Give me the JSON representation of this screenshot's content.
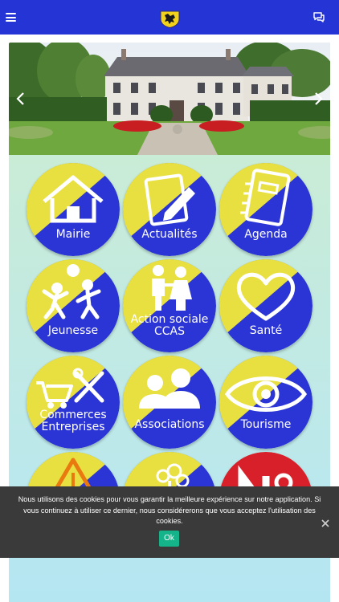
{
  "header": {
    "menu_icon": "hamburger-icon",
    "logo_icon": "crest-icon",
    "chat_icon": "chat-icon"
  },
  "slider": {
    "prev_icon": "chevron-left-icon",
    "next_icon": "chevron-right-icon"
  },
  "tiles": [
    {
      "label": "Mairie",
      "icon": "house-icon"
    },
    {
      "label": "Actualités",
      "icon": "notepad-pencil-icon"
    },
    {
      "label": "Agenda",
      "icon": "notebook-icon"
    },
    {
      "label": "Jeunesse",
      "icon": "children-icon"
    },
    {
      "label": "Action sociale",
      "label2": "CCAS",
      "icon": "couple-icon"
    },
    {
      "label": "Santé",
      "icon": "heart-icon"
    },
    {
      "label": "Commerces",
      "label2": "Entreprises",
      "icon": "cart-tools-icon"
    },
    {
      "label": "Associations",
      "icon": "people-icon"
    },
    {
      "label": "Tourisme",
      "icon": "eye-icon"
    }
  ],
  "colors": {
    "topbar": "#2534d4",
    "tile_blue": "#2b35d6",
    "tile_yellow": "#e8e041",
    "tile_red": "#d8202a",
    "cookie_bg": "#3a3a3a",
    "ok_button": "#15b38a"
  },
  "cookie": {
    "text": "Nous utilisons des cookies pour vous garantir la meilleure expérience sur notre application. Si vous continuez à utiliser ce dernier, nous considérerons que vous acceptez l'utilisation des cookies.",
    "ok_label": "Ok",
    "close_icon": "close-icon"
  }
}
